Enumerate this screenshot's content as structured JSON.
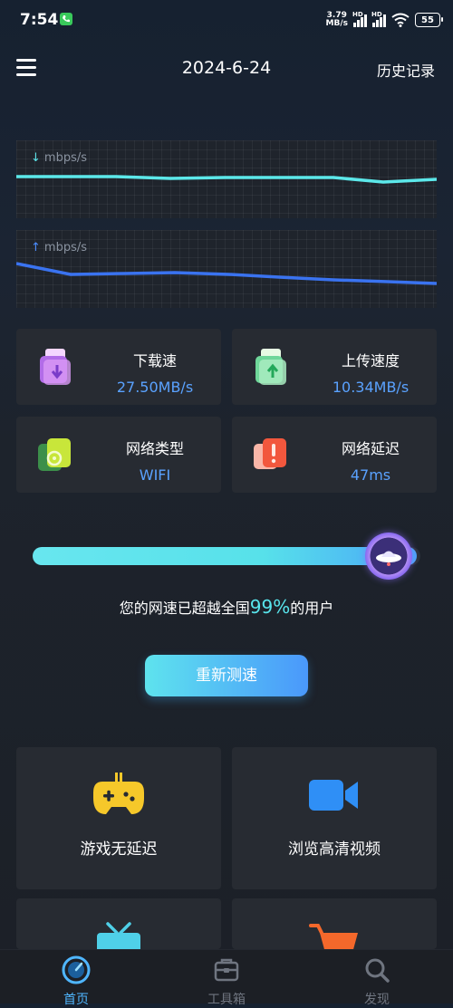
{
  "status_bar": {
    "time": "7:54",
    "network_speed_value": "3.79",
    "network_speed_unit": "MB/s",
    "sim1_label": "HD",
    "sim2_label": "HD",
    "battery": "55"
  },
  "header": {
    "date": "2024-6-24",
    "history_label": "历史记录"
  },
  "graphs": {
    "download": {
      "arrow": "↓",
      "unit": "mbps/s",
      "color": "#5ce8ea"
    },
    "upload": {
      "arrow": "↑",
      "unit": "mbps/s",
      "color": "#3a73f0"
    }
  },
  "stats": {
    "download": {
      "label": "下载速",
      "value": "27.50MB/s"
    },
    "upload": {
      "label": "上传速度",
      "value": "10.34MB/s"
    },
    "network_type": {
      "label": "网络类型",
      "value": "WIFI"
    },
    "latency": {
      "label": "网络延迟",
      "value": "47ms"
    }
  },
  "ranking": {
    "progress": 0.99,
    "prefix": "您的网速已超越全国",
    "percent": "99%",
    "suffix": "的用户"
  },
  "retest_label": "重新测速",
  "features": {
    "game": {
      "label": "游戏无延迟",
      "icon": "gamepad-icon"
    },
    "video": {
      "label": "浏览高清视频",
      "icon": "video-camera-icon"
    },
    "tv": {
      "icon": "tv-icon"
    },
    "shopping": {
      "icon": "shopping-cart-icon"
    }
  },
  "tabs": {
    "home": "首页",
    "tools": "工具箱",
    "discover": "发现"
  },
  "colors": {
    "accent_cyan": "#58e5ec",
    "accent_blue": "#5aa2ff",
    "card_bg": "#272b32"
  }
}
